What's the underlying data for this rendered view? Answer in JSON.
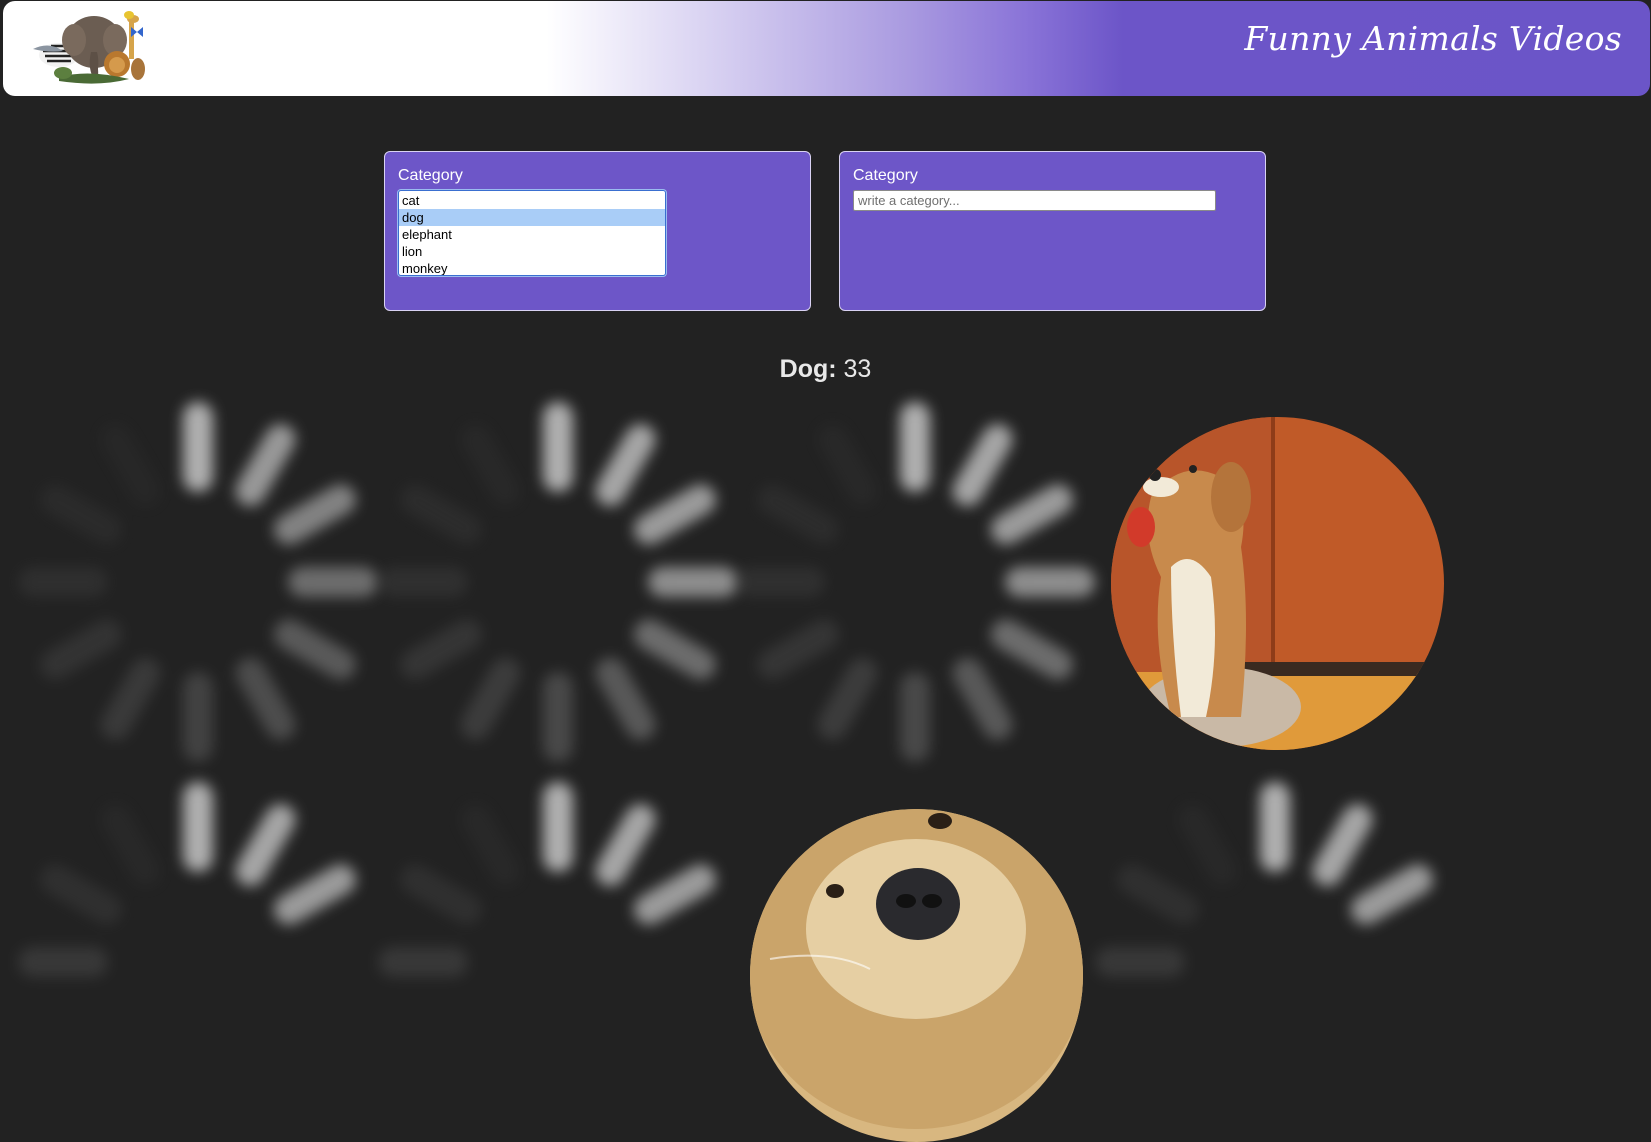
{
  "header": {
    "logo_icon": "animals-collage-logo",
    "title": "Funny Animals Videos"
  },
  "filters": {
    "select_panel": {
      "label": "Category",
      "options": [
        "cat",
        "dog",
        "elephant",
        "lion",
        "monkey"
      ],
      "selected": "dog"
    },
    "input_panel": {
      "label": "Category",
      "placeholder": "write a category...",
      "value": ""
    }
  },
  "results": {
    "category_label": "Dog:",
    "count": "33"
  },
  "gallery": {
    "loading_icon": "loading-spinner-icon",
    "loaded_videos": [
      "dog-video-thumbnail",
      "dog-video-thumbnail"
    ]
  },
  "colors": {
    "accent": "#6d56c8",
    "background": "#222222",
    "selected_option": "#a9cdf7"
  }
}
